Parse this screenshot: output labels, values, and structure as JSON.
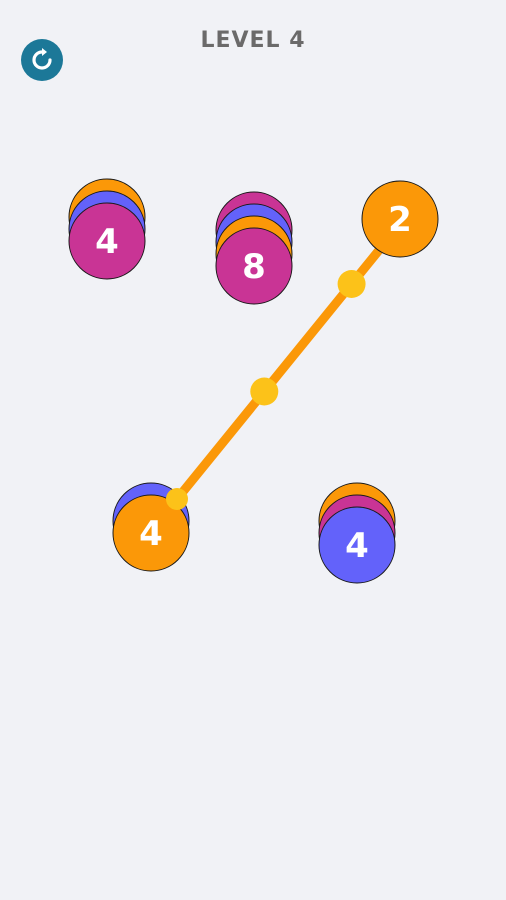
{
  "header": {
    "level_label": "LEVEL 4",
    "restart_icon": "restart-icon"
  },
  "colors": {
    "background": "#f1f2f6",
    "orange": "#fb9808",
    "magenta": "#c93495",
    "blue": "#6362fa",
    "connector": "#fb9808",
    "connector_node": "#fcc219",
    "restart_button": "#1c7898"
  },
  "board": {
    "stacks": [
      {
        "id": "stack-1",
        "top_label": "4",
        "layers": [
          "orange",
          "blue",
          "magenta"
        ]
      },
      {
        "id": "stack-2",
        "top_label": "8",
        "layers": [
          "magenta",
          "blue",
          "orange",
          "magenta"
        ]
      },
      {
        "id": "stack-3",
        "top_label": "2",
        "layers": [
          "orange"
        ]
      },
      {
        "id": "stack-4",
        "top_label": "4",
        "layers": [
          "blue",
          "orange"
        ]
      },
      {
        "id": "stack-5",
        "top_label": "4",
        "layers": [
          "orange",
          "magenta",
          "blue"
        ]
      }
    ],
    "connection": {
      "from": "stack-4",
      "to": "stack-3",
      "nodes": 3
    }
  }
}
